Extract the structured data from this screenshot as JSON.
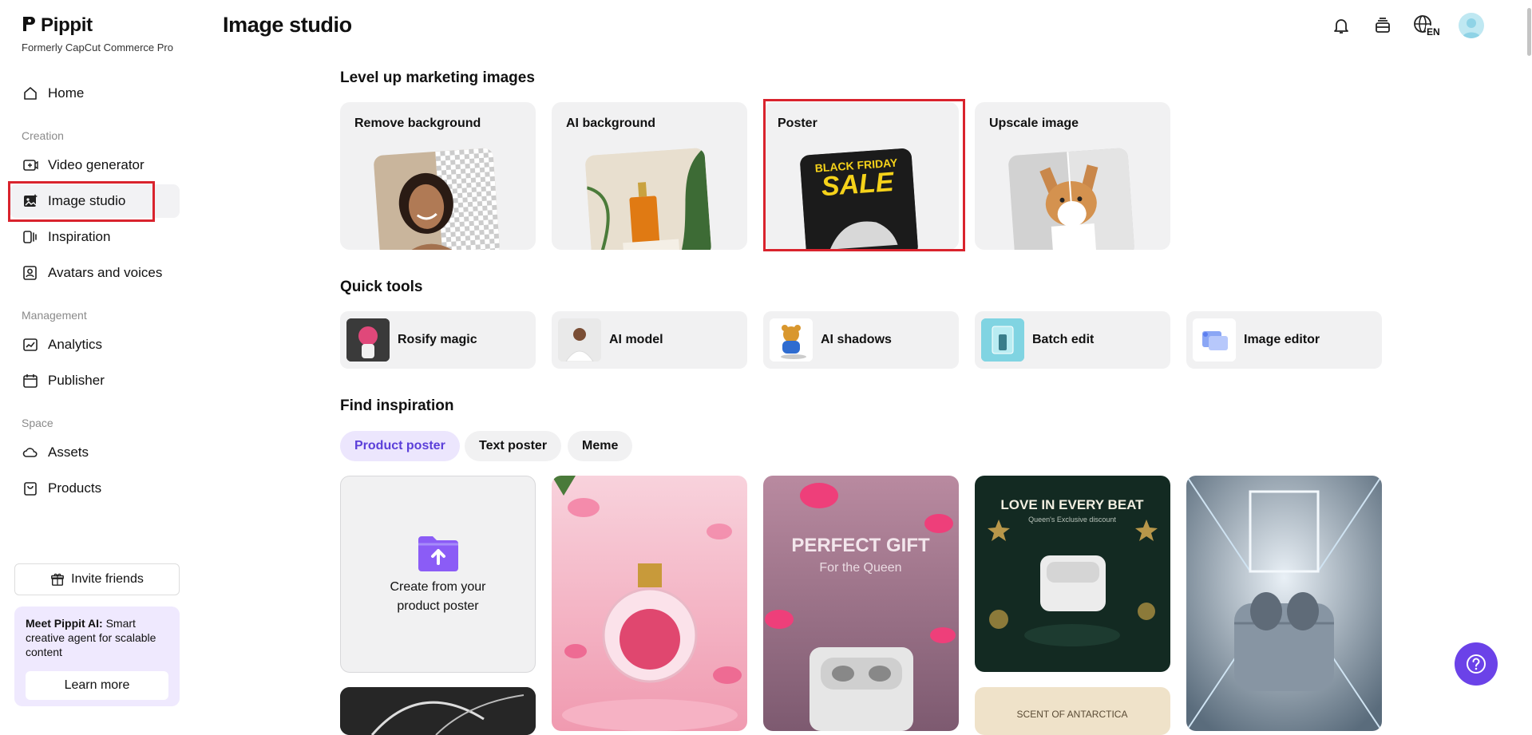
{
  "app": {
    "brand_name": "Pippit",
    "brand_sub": "Formerly CapCut Commerce Pro"
  },
  "sidebar": {
    "home": "Home",
    "section_creation": "Creation",
    "video_generator": "Video generator",
    "image_studio": "Image studio",
    "inspiration": "Inspiration",
    "avatars_voices": "Avatars and voices",
    "section_management": "Management",
    "analytics": "Analytics",
    "publisher": "Publisher",
    "section_space": "Space",
    "assets": "Assets",
    "products": "Products",
    "invite": "Invite friends",
    "promo_title": "Meet Pippit AI:",
    "promo_body": " Smart creative agent for scalable content",
    "promo_button": "Learn more"
  },
  "header": {
    "title": "Image studio",
    "lang": "EN"
  },
  "marketing": {
    "title": "Level up marketing images",
    "cards": [
      "Remove background",
      "AI background",
      "Poster",
      "Upscale image"
    ],
    "poster_line1": "BLACK FRIDAY",
    "poster_line2": "SALE"
  },
  "quick_tools": {
    "title": "Quick tools",
    "items": [
      "Rosify magic",
      "AI model",
      "AI shadows",
      "Batch edit",
      "Image editor"
    ]
  },
  "inspiration": {
    "title": "Find inspiration",
    "chips": [
      "Product poster",
      "Text poster",
      "Meme"
    ],
    "create_line1": "Create from your",
    "create_line2": "product poster",
    "poster2_title": "PERFECT GIFT",
    "poster2_sub": "For the Queen",
    "poster3_title": "LOVE IN EVERY BEAT",
    "poster3_sub": "Queen's Exclusive discount",
    "poster5_text": "SCENT OF ANTARCTICA"
  },
  "colors": {
    "accent": "#6b42e8",
    "highlight": "#d9232d",
    "chip_active_bg": "#ece6fd",
    "chip_active_text": "#5b3fd9"
  }
}
